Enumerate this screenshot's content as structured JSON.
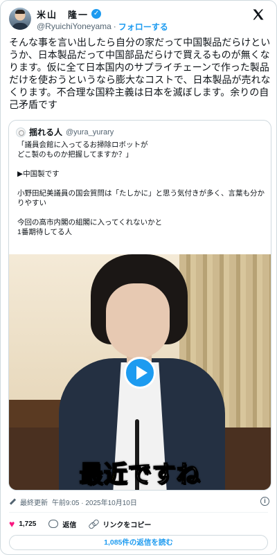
{
  "author": {
    "name": "米山　隆一",
    "handle": "@RyuichiYoneyama",
    "separator": "·",
    "follow_label": "フォローする"
  },
  "post_text": "そんな事を言い出したら自分の家だって中国製品だらけというか、日本製品だって中国部品だらけで買えるものが無くなります。仮に全て日本国内のサプライチェーンで作った製品だけを使おうというなら膨大なコストで、日本製品が売れなくります。不合理な国粋主義は日本を滅ぼします。余りの自己矛盾です",
  "quote": {
    "name": "揺れる人",
    "handle": "@yura_yurary",
    "text": "「議員会館に入ってるお掃除ロボットが\nどこ製のものか把握してますか？」\n\n▶中国製です\n\n小野田紀美議員の国会質問は「たしかに」と思う気付きが多く、言葉も分かりやすい\n\n今回の高市内閣の組閣に入ってくれないかと\n1番期待してる人",
    "video_caption_highlight": "最近",
    "video_caption_rest": "ですね"
  },
  "meta": {
    "edited_label": "最終更新",
    "timestamp": "午前9:05 · 2025年10月10日"
  },
  "actions": {
    "like_count": "1,725",
    "reply_label": "返信",
    "copy_link_label": "リンクをコピー"
  },
  "read_replies_label": "1,085件の返信を読む",
  "icons": {
    "verified": "verified-badge-icon",
    "brand": "x-logo-icon",
    "like": "heart-icon",
    "reply": "reply-icon",
    "link": "link-icon",
    "info": "info-icon",
    "play": "play-icon",
    "edit": "edit-pencil-icon"
  },
  "colors": {
    "accent": "#1d9bf0",
    "like": "#f91880",
    "caption_highlight": "#ffe600"
  }
}
